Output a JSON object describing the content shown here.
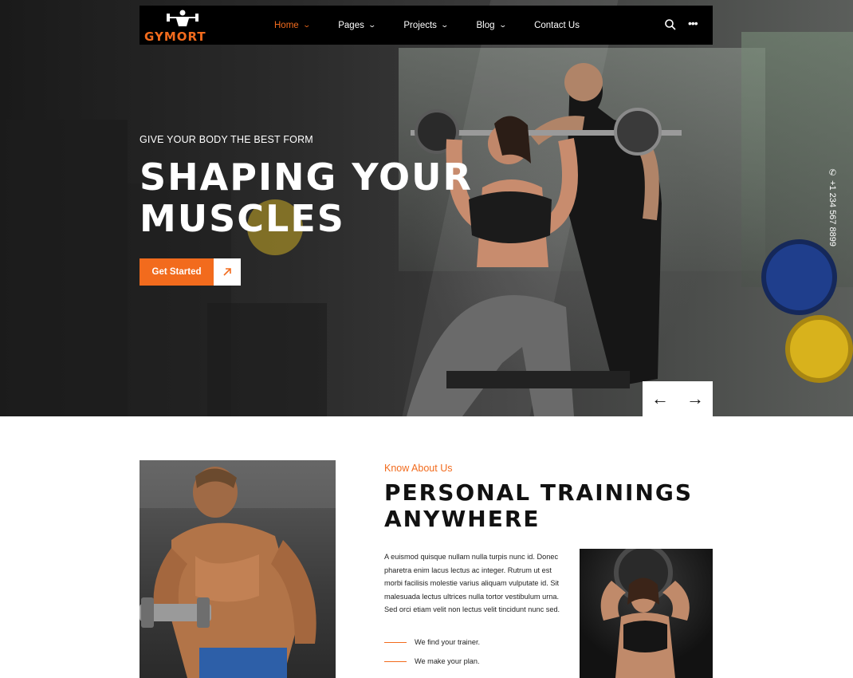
{
  "brand": {
    "name": "GYMORT",
    "accent": "#f26b1d"
  },
  "nav": {
    "items": [
      {
        "label": "Home",
        "active": true,
        "has_dropdown": true
      },
      {
        "label": "Pages",
        "active": false,
        "has_dropdown": true
      },
      {
        "label": "Projects",
        "active": false,
        "has_dropdown": true
      },
      {
        "label": "Blog",
        "active": false,
        "has_dropdown": true
      },
      {
        "label": "Contact Us",
        "active": false,
        "has_dropdown": false
      }
    ],
    "chevron": "⌄",
    "search_icon": "search-icon",
    "more_icon": "more-dots-icon",
    "more_glyph": "•••"
  },
  "hero": {
    "eyebrow": "GIVE YOUR BODY THE BEST FORM",
    "title_line1": "SHAPING YOUR",
    "title_line2": "MUSCLES",
    "cta_label": "Get Started",
    "cta_icon": "arrow-up-right-icon",
    "phone": "+1 234 567 8899",
    "prev_glyph": "←",
    "next_glyph": "→"
  },
  "about": {
    "eyebrow": "Know About Us",
    "title_line1": "PERSONAL TRAININGS",
    "title_line2": "ANYWHERE",
    "body": "A euismod quisque nullam nulla turpis nunc id. Donec pharetra enim lacus lectus ac integer. Rutrum ut est morbi facilisis molestie varius aliquam vulputate id. Sit malesuada lectus ultrices nulla tortor vestibulum urna. Sed orci etiam velit non lectus velit tincidunt nunc sed.",
    "bullets": [
      "We find your trainer.",
      "We make your plan."
    ]
  }
}
